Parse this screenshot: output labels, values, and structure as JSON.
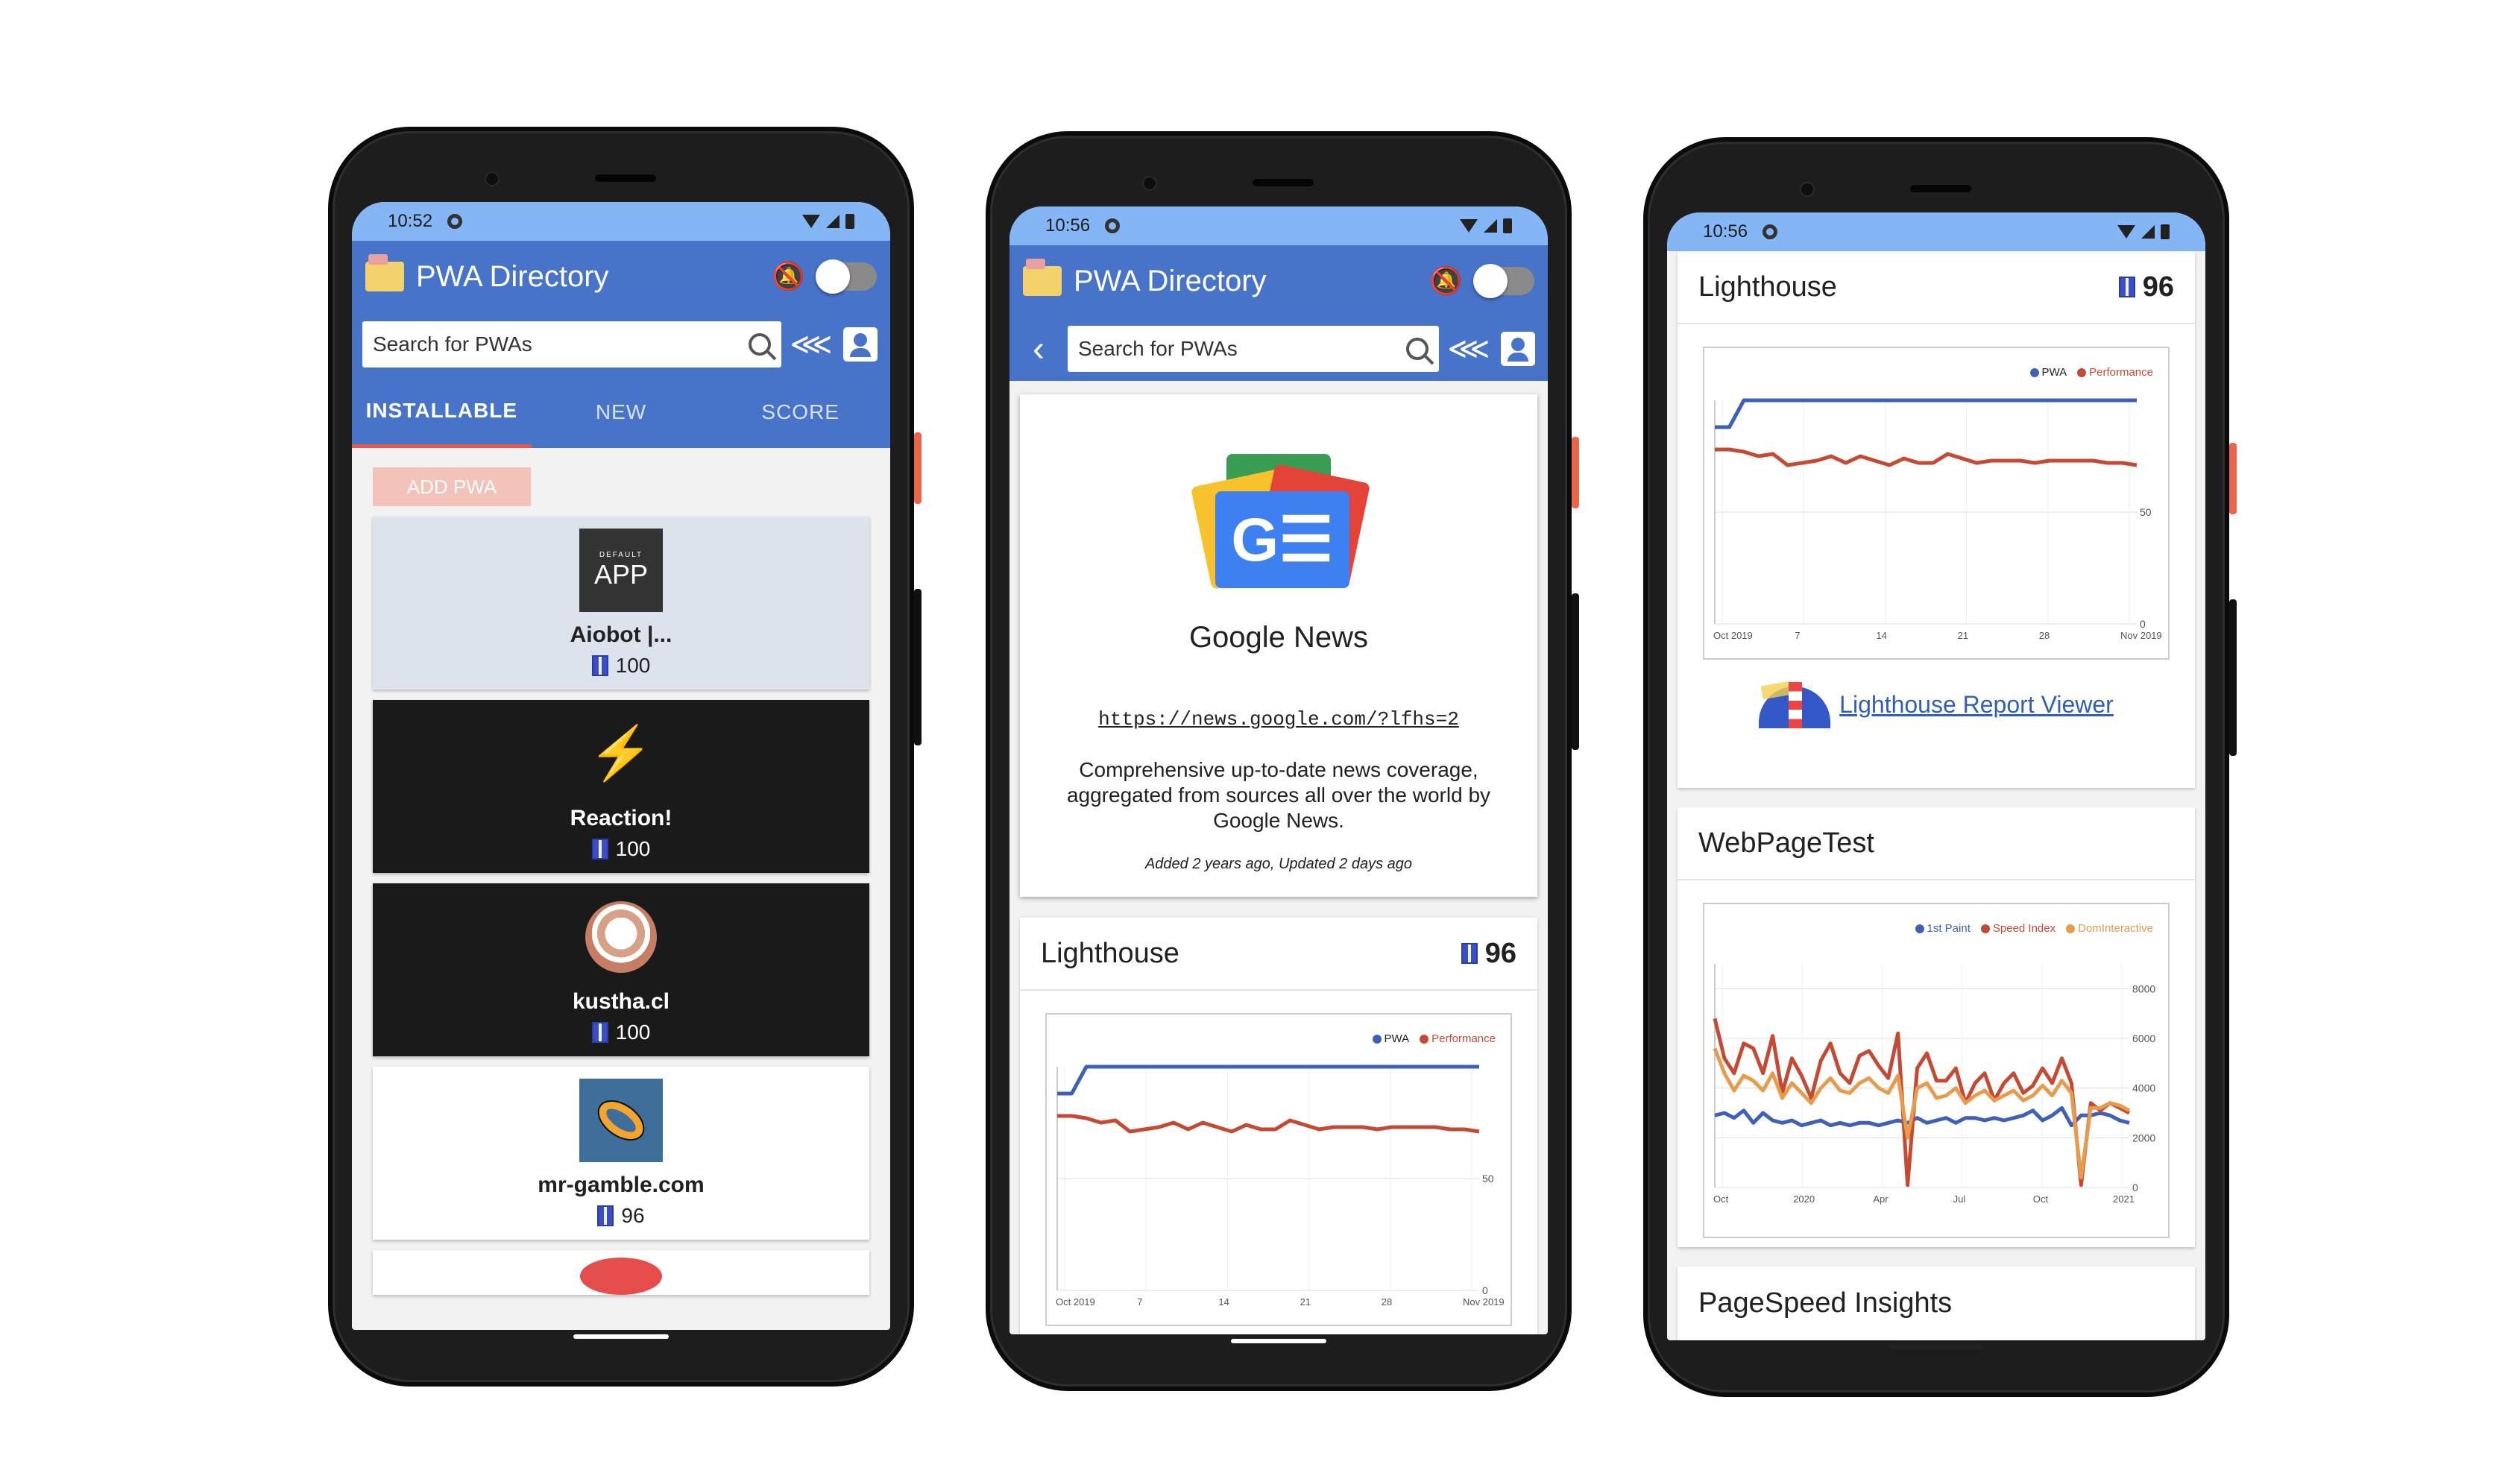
{
  "phones": [
    {
      "status_time": "10:52",
      "app_title": "PWA Directory",
      "search_placeholder": "Search for PWAs",
      "tabs": [
        {
          "label": "INSTALLABLE",
          "active": true
        },
        {
          "label": "NEW",
          "active": false
        },
        {
          "label": "SCORE",
          "active": false
        }
      ],
      "add_button": "ADD PWA",
      "cards": [
        {
          "name": "Aiobot |...",
          "score": "100",
          "logo": "default-app-logo",
          "logo_top": "DEFAULT",
          "logo_main": "APP",
          "bg": "#dde3ec",
          "fg": "#212121"
        },
        {
          "name": "Reaction!",
          "score": "100",
          "logo": "lightning-bolt-icon",
          "bg": "#1a1a1a",
          "fg": "#ffffff"
        },
        {
          "name": "kustha.cl",
          "score": "100",
          "logo": "shell-logo",
          "bg": "#1a1a1a",
          "fg": "#ffffff"
        },
        {
          "name": "mr-gamble.com",
          "score": "96",
          "logo": "ring-logo",
          "bg": "#ffffff",
          "fg": "#212121"
        }
      ]
    },
    {
      "status_time": "10:56",
      "app_title": "PWA Directory",
      "search_placeholder": "Search for PWAs",
      "detail": {
        "title": "Google News",
        "url": "https://news.google.com/?lfhs=2",
        "description": "Comprehensive up-to-date news coverage, aggregated from sources all over the world by Google News.",
        "dates": "Added 2 years ago, Updated 2 days ago"
      },
      "lighthouse": {
        "title": "Lighthouse",
        "score": "96"
      }
    },
    {
      "status_time": "10:56",
      "lighthouse": {
        "title": "Lighthouse",
        "score": "96",
        "report_link": "Lighthouse Report Viewer"
      },
      "webpagetest": {
        "title": "WebPageTest"
      },
      "pagespeed": {
        "title": "PageSpeed Insights"
      }
    }
  ],
  "colors": {
    "appbar": "#4773c9",
    "statusbar": "#84b5f4",
    "accent": "#e8564c",
    "pwa_line": "#3f5fb8",
    "perf_line": "#c54a33",
    "first_paint": "#3f5fb8",
    "speed_index": "#c54a33",
    "dom_interactive": "#e79b4c"
  },
  "chart_data": [
    {
      "type": "line",
      "legend": "top-right",
      "x_ticks": [
        "Oct 2019",
        "7",
        "14",
        "21",
        "28",
        "Nov 2019"
      ],
      "y_ticks": [
        "50",
        "0"
      ],
      "ylim": [
        0,
        100
      ],
      "series": [
        {
          "name": "PWA",
          "values": [
            88,
            88,
            100,
            100,
            100,
            100,
            100,
            100,
            100,
            100,
            100,
            100,
            100,
            100,
            100,
            100,
            100,
            100,
            100,
            100,
            100,
            100,
            100,
            100,
            100,
            100,
            100,
            100,
            100,
            100
          ]
        },
        {
          "name": "Performance",
          "values": [
            78,
            78,
            77,
            75,
            76,
            71,
            72,
            73,
            75,
            72,
            75,
            73,
            71,
            74,
            72,
            72,
            76,
            74,
            72,
            73,
            73,
            73,
            72,
            73,
            73,
            73,
            73,
            72,
            72,
            71
          ]
        }
      ]
    },
    {
      "type": "line",
      "legend": "top-right",
      "x_ticks": [
        "Oct",
        "2020",
        "Apr",
        "Jul",
        "Oct",
        "2021"
      ],
      "y_ticks": [
        "8000",
        "6000",
        "4000",
        "2000",
        "0"
      ],
      "ylim": [
        0,
        9000
      ],
      "series": [
        {
          "name": "1st Paint",
          "values": [
            2900,
            3000,
            2800,
            3100,
            2600,
            3000,
            2700,
            2600,
            2700,
            2500,
            2600,
            2700,
            2500,
            2600,
            2500,
            2600,
            2600,
            2500,
            2600,
            2700,
            2600,
            2800,
            2600,
            2700,
            2800,
            2600,
            2800,
            2800,
            2700,
            2800,
            2700,
            2800,
            2900,
            3100,
            2700,
            2900,
            3200,
            2500,
            2900,
            2900,
            3000,
            2900,
            2700,
            2600
          ]
        },
        {
          "name": "Speed Index",
          "values": [
            6800,
            5200,
            4600,
            5800,
            5600,
            4600,
            6100,
            3800,
            5200,
            4500,
            3600,
            5100,
            5800,
            4600,
            4200,
            5300,
            5500,
            4900,
            4400,
            6200,
            100,
            4800,
            5400,
            4300,
            4300,
            4800,
            3400,
            4200,
            4600,
            3500,
            4200,
            4600,
            3800,
            4100,
            4800,
            4200,
            5200,
            4200,
            100,
            3400,
            3100,
            3400,
            3200,
            3000
          ]
        },
        {
          "name": "DomInteractive",
          "values": [
            5600,
            4600,
            3900,
            4500,
            4300,
            3900,
            4600,
            3600,
            4200,
            3800,
            3400,
            4000,
            4400,
            3900,
            3800,
            4200,
            4400,
            4000,
            3800,
            4500,
            2000,
            4000,
            4200,
            3600,
            3700,
            4000,
            3400,
            3700,
            3900,
            3500,
            3700,
            3900,
            3500,
            3700,
            4100,
            3700,
            4300,
            3800,
            400,
            3200,
            3200,
            3400,
            3300,
            3100
          ]
        }
      ]
    }
  ]
}
